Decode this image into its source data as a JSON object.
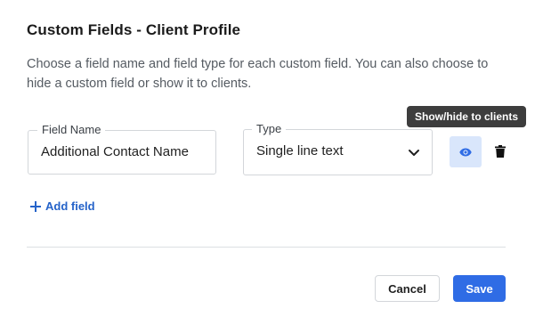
{
  "dialog": {
    "title": "Custom Fields - Client Profile",
    "description": "Choose a field name and field type for each custom field. You can also choose to hide a custom field or show it to clients."
  },
  "custom_field": {
    "name_label": "Field Name",
    "name_value": "Additional Contact Name",
    "type_label": "Type",
    "type_value": "Single line text",
    "visibility_icon": "eye-icon",
    "delete_icon": "trash-icon"
  },
  "tooltip": {
    "text": "Show/hide to clients"
  },
  "actions": {
    "add_field_label": "Add field",
    "add_field_icon": "plus-icon",
    "cancel_label": "Cancel",
    "save_label": "Save"
  },
  "colors": {
    "accent": "#2f6ce5",
    "link": "#2563c9",
    "eye_button_bg": "#d9e6fb",
    "tooltip_bg": "#3d3d3d"
  }
}
